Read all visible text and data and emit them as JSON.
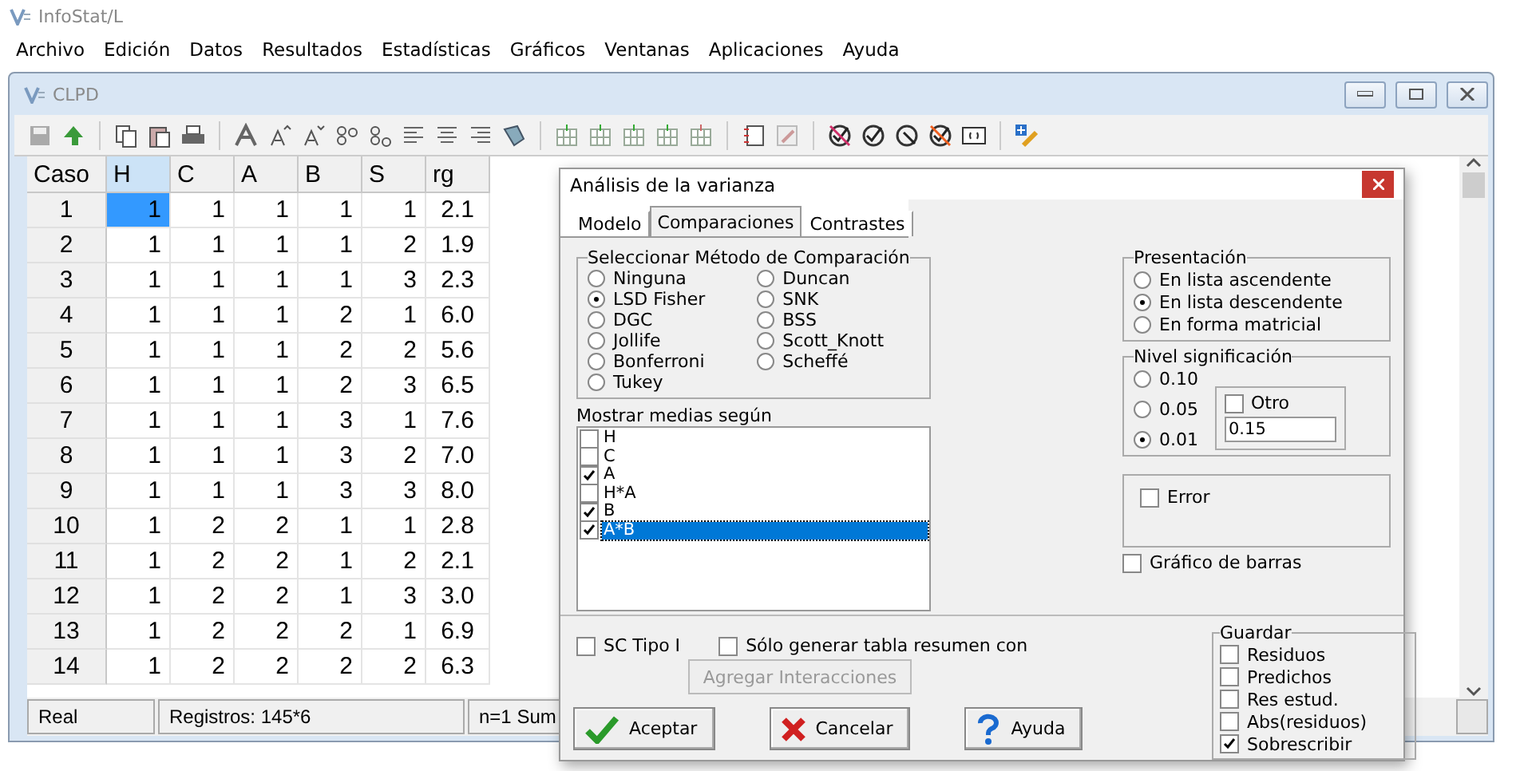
{
  "app": {
    "title": "InfoStat/L"
  },
  "menu": [
    "Archivo",
    "Edición",
    "Datos",
    "Resultados",
    "Estadísticas",
    "Gráficos",
    "Ventanas",
    "Aplicaciones",
    "Ayuda"
  ],
  "child_window": {
    "title": "CLPD"
  },
  "grid": {
    "columns": [
      {
        "label": "Caso",
        "selected": false
      },
      {
        "label": "H",
        "selected": true
      },
      {
        "label": "C",
        "selected": false
      },
      {
        "label": "A",
        "selected": false
      },
      {
        "label": "B",
        "selected": false
      },
      {
        "label": "S",
        "selected": false
      },
      {
        "label": "rg",
        "selected": false
      }
    ],
    "rows": [
      {
        "case": "1",
        "selected": true,
        "cells": [
          "1",
          "1",
          "1",
          "1",
          "1",
          "2.1"
        ]
      },
      {
        "case": "2",
        "selected": false,
        "cells": [
          "1",
          "1",
          "1",
          "1",
          "2",
          "1.9"
        ]
      },
      {
        "case": "3",
        "selected": false,
        "cells": [
          "1",
          "1",
          "1",
          "1",
          "3",
          "2.3"
        ]
      },
      {
        "case": "4",
        "selected": false,
        "cells": [
          "1",
          "1",
          "1",
          "2",
          "1",
          "6.0"
        ]
      },
      {
        "case": "5",
        "selected": false,
        "cells": [
          "1",
          "1",
          "1",
          "2",
          "2",
          "5.6"
        ]
      },
      {
        "case": "6",
        "selected": false,
        "cells": [
          "1",
          "1",
          "1",
          "2",
          "3",
          "6.5"
        ]
      },
      {
        "case": "7",
        "selected": false,
        "cells": [
          "1",
          "1",
          "1",
          "3",
          "1",
          "7.6"
        ]
      },
      {
        "case": "8",
        "selected": false,
        "cells": [
          "1",
          "1",
          "1",
          "3",
          "2",
          "7.0"
        ]
      },
      {
        "case": "9",
        "selected": false,
        "cells": [
          "1",
          "1",
          "1",
          "3",
          "3",
          "8.0"
        ]
      },
      {
        "case": "10",
        "selected": false,
        "cells": [
          "1",
          "2",
          "2",
          "1",
          "1",
          "2.8"
        ]
      },
      {
        "case": "11",
        "selected": false,
        "cells": [
          "1",
          "2",
          "2",
          "1",
          "2",
          "2.1"
        ]
      },
      {
        "case": "12",
        "selected": false,
        "cells": [
          "1",
          "2",
          "2",
          "1",
          "3",
          "3.0"
        ]
      },
      {
        "case": "13",
        "selected": false,
        "cells": [
          "1",
          "2",
          "2",
          "2",
          "1",
          "6.9"
        ]
      },
      {
        "case": "14",
        "selected": false,
        "cells": [
          "1",
          "2",
          "2",
          "2",
          "2",
          "6.3"
        ]
      }
    ]
  },
  "status_bar": [
    "Real",
    "Registros: 145*6",
    "n=1  Sum"
  ],
  "dialog": {
    "title": "Análisis de la varianza",
    "tabs": [
      {
        "label": "Modelo",
        "selected": false
      },
      {
        "label": "Comparaciones",
        "selected": true
      },
      {
        "label": "Contrastes",
        "selected": false
      }
    ],
    "method_group": {
      "title": "Seleccionar Método de Comparación",
      "options": [
        {
          "label": "Ninguna",
          "selected": false
        },
        {
          "label": "LSD Fisher",
          "selected": true
        },
        {
          "label": "DGC",
          "selected": false
        },
        {
          "label": "Jollife",
          "selected": false
        },
        {
          "label": "Bonferroni",
          "selected": false
        },
        {
          "label": "Tukey",
          "selected": false
        },
        {
          "label": "Duncan",
          "selected": false
        },
        {
          "label": "SNK",
          "selected": false
        },
        {
          "label": "BSS",
          "selected": false
        },
        {
          "label": "Scott_Knott",
          "selected": false
        },
        {
          "label": "Scheffé",
          "selected": false
        }
      ]
    },
    "means_list": {
      "label": "Mostrar medias según",
      "items": [
        {
          "label": "H",
          "checked": false,
          "selected": false
        },
        {
          "label": "C",
          "checked": false,
          "selected": false
        },
        {
          "label": "A",
          "checked": true,
          "selected": false
        },
        {
          "label": "H*A",
          "checked": false,
          "selected": false
        },
        {
          "label": "B",
          "checked": true,
          "selected": false
        },
        {
          "label": "A*B",
          "checked": true,
          "selected": true
        }
      ]
    },
    "presentation": {
      "title": "Presentación",
      "options": [
        {
          "label": "En lista ascendente",
          "selected": false
        },
        {
          "label": "En lista descendente",
          "selected": true
        },
        {
          "label": "En forma matricial",
          "selected": false
        }
      ]
    },
    "significance": {
      "title": "Nivel significación",
      "options": [
        {
          "label": "0.10",
          "selected": false
        },
        {
          "label": "0.05",
          "selected": false
        },
        {
          "label": "0.01",
          "selected": true
        }
      ],
      "other": {
        "label": "Otro",
        "checked": false,
        "value": "0.15"
      }
    },
    "error": {
      "label": "Error",
      "checked": false
    },
    "bar_chart": {
      "label": "Gráfico de barras",
      "checked": false
    },
    "sc_type": {
      "label": "SC Tipo I",
      "checked": false
    },
    "summary_only": {
      "label": "Sólo generar tabla resumen con",
      "checked": false
    },
    "add_interactions": {
      "label": "Agregar Interacciones",
      "disabled": true
    },
    "buttons": [
      {
        "label": "Aceptar",
        "kind": "accept"
      },
      {
        "label": "Cancelar",
        "kind": "cancel"
      },
      {
        "label": "Ayuda",
        "kind": "help"
      }
    ],
    "save": {
      "title": "Guardar",
      "options": [
        {
          "label": "Residuos",
          "checked": false
        },
        {
          "label": "Predichos",
          "checked": false
        },
        {
          "label": "Res estud.",
          "checked": false
        },
        {
          "label": "Abs(residuos)",
          "checked": false
        },
        {
          "label": "Sobrescribir",
          "checked": true
        }
      ]
    }
  }
}
